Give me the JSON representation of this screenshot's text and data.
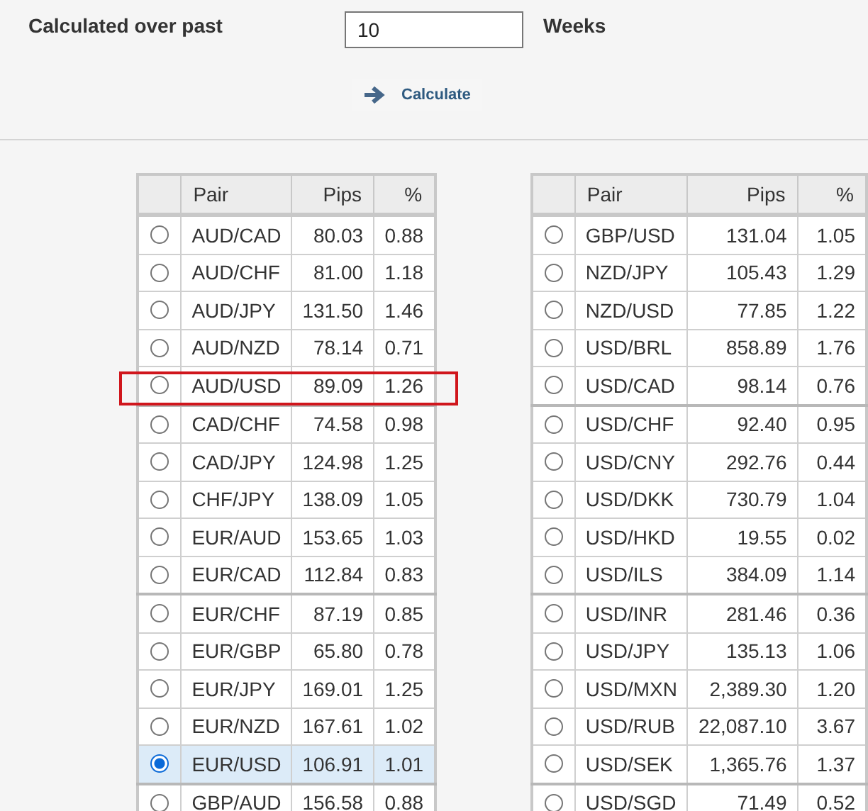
{
  "form": {
    "label": "Calculated over past",
    "weeks_value": "10",
    "unit": "Weeks",
    "calculate_button": "Calculate"
  },
  "tables": [
    {
      "columns": [
        "Pair",
        "Pips",
        "%"
      ],
      "rows": [
        {
          "pair": "AUD/CAD",
          "pips": "80.03",
          "percent": "0.88",
          "selected": false,
          "highlighted": false
        },
        {
          "pair": "AUD/CHF",
          "pips": "81.00",
          "percent": "1.18",
          "selected": false,
          "highlighted": false
        },
        {
          "pair": "AUD/JPY",
          "pips": "131.50",
          "percent": "1.46",
          "selected": false,
          "highlighted": false
        },
        {
          "pair": "AUD/NZD",
          "pips": "78.14",
          "percent": "0.71",
          "selected": false,
          "highlighted": false
        },
        {
          "pair": "AUD/USD",
          "pips": "89.09",
          "percent": "1.26",
          "selected": false,
          "highlighted": true
        },
        {
          "pair": "CAD/CHF",
          "pips": "74.58",
          "percent": "0.98",
          "selected": false,
          "highlighted": false
        },
        {
          "pair": "CAD/JPY",
          "pips": "124.98",
          "percent": "1.25",
          "selected": false,
          "highlighted": false
        },
        {
          "pair": "CHF/JPY",
          "pips": "138.09",
          "percent": "1.05",
          "selected": false,
          "highlighted": false
        },
        {
          "pair": "EUR/AUD",
          "pips": "153.65",
          "percent": "1.03",
          "selected": false,
          "highlighted": false
        },
        {
          "pair": "EUR/CAD",
          "pips": "112.84",
          "percent": "0.83",
          "selected": false,
          "highlighted": false
        },
        {
          "pair": "EUR/CHF",
          "pips": "87.19",
          "percent": "0.85",
          "selected": false,
          "highlighted": false
        },
        {
          "pair": "EUR/GBP",
          "pips": "65.80",
          "percent": "0.78",
          "selected": false,
          "highlighted": false
        },
        {
          "pair": "EUR/JPY",
          "pips": "169.01",
          "percent": "1.25",
          "selected": false,
          "highlighted": false
        },
        {
          "pair": "EUR/NZD",
          "pips": "167.61",
          "percent": "1.02",
          "selected": false,
          "highlighted": false
        },
        {
          "pair": "EUR/USD",
          "pips": "106.91",
          "percent": "1.01",
          "selected": true,
          "highlighted": false
        },
        {
          "pair": "GBP/AUD",
          "pips": "156.58",
          "percent": "0.88",
          "selected": false,
          "highlighted": false
        }
      ]
    },
    {
      "columns": [
        "Pair",
        "Pips",
        "%"
      ],
      "rows": [
        {
          "pair": "GBP/USD",
          "pips": "131.04",
          "percent": "1.05",
          "selected": false,
          "highlighted": false
        },
        {
          "pair": "NZD/JPY",
          "pips": "105.43",
          "percent": "1.29",
          "selected": false,
          "highlighted": false
        },
        {
          "pair": "NZD/USD",
          "pips": "77.85",
          "percent": "1.22",
          "selected": false,
          "highlighted": false
        },
        {
          "pair": "USD/BRL",
          "pips": "858.89",
          "percent": "1.76",
          "selected": false,
          "highlighted": false
        },
        {
          "pair": "USD/CAD",
          "pips": "98.14",
          "percent": "0.76",
          "selected": false,
          "highlighted": false
        },
        {
          "pair": "USD/CHF",
          "pips": "92.40",
          "percent": "0.95",
          "selected": false,
          "highlighted": false
        },
        {
          "pair": "USD/CNY",
          "pips": "292.76",
          "percent": "0.44",
          "selected": false,
          "highlighted": false
        },
        {
          "pair": "USD/DKK",
          "pips": "730.79",
          "percent": "1.04",
          "selected": false,
          "highlighted": false
        },
        {
          "pair": "USD/HKD",
          "pips": "19.55",
          "percent": "0.02",
          "selected": false,
          "highlighted": false
        },
        {
          "pair": "USD/ILS",
          "pips": "384.09",
          "percent": "1.14",
          "selected": false,
          "highlighted": false
        },
        {
          "pair": "USD/INR",
          "pips": "281.46",
          "percent": "0.36",
          "selected": false,
          "highlighted": false
        },
        {
          "pair": "USD/JPY",
          "pips": "135.13",
          "percent": "1.06",
          "selected": false,
          "highlighted": false
        },
        {
          "pair": "USD/MXN",
          "pips": "2,389.30",
          "percent": "1.20",
          "selected": false,
          "highlighted": false
        },
        {
          "pair": "USD/RUB",
          "pips": "22,087.10",
          "percent": "3.67",
          "selected": false,
          "highlighted": false
        },
        {
          "pair": "USD/SEK",
          "pips": "1,365.76",
          "percent": "1.37",
          "selected": false,
          "highlighted": false
        },
        {
          "pair": "USD/SGD",
          "pips": "71.49",
          "percent": "0.52",
          "selected": false,
          "highlighted": false
        }
      ]
    }
  ]
}
